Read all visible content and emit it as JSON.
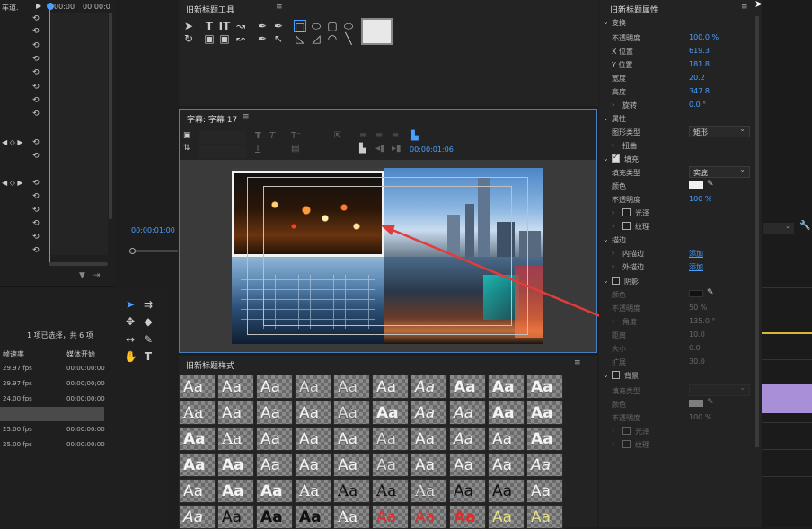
{
  "left_panel": {
    "top_label": "车道.",
    "timecode_top": "00:00",
    "timecode_top_right": "00:00:0",
    "timecode_mid": "00:00:01:00",
    "items_selected": "1 项已选择，共 6 项",
    "col_frame_rate": "帧速率",
    "col_media_start": "媒体开始",
    "rows": [
      {
        "fps": "29.97 fps",
        "start": "00:00:00:00"
      },
      {
        "fps": "29.97 fps",
        "start": "00;00;00;00"
      },
      {
        "fps": "24.00 fps",
        "start": "00:00:00:00"
      },
      {
        "fps": "",
        "start": ""
      },
      {
        "fps": "25.00 fps",
        "start": "00:00:00:00"
      },
      {
        "fps": "25.00 fps",
        "start": "00:00:00:00"
      }
    ]
  },
  "title_tools": {
    "title": "旧新标题工具"
  },
  "title_editor": {
    "title": "字幕: 字幕 17",
    "timecode": "00:00:01:06"
  },
  "title_styles": {
    "title": "旧新标题样式",
    "sample_text": "Aa"
  },
  "properties": {
    "title": "旧新标题属性",
    "transform": {
      "heading": "变换",
      "opacity_label": "不透明度",
      "opacity": "100.0 %",
      "x_label": "X 位置",
      "x": "619.3",
      "y_label": "Y 位置",
      "y": "181.8",
      "width_label": "宽度",
      "width": "20.2",
      "height_label": "高度",
      "height": "347.8",
      "rotation_label": "旋转",
      "rotation": "0.0 °"
    },
    "attributes": {
      "heading": "属性",
      "shape_type_label": "图形类型",
      "shape_type": "矩形",
      "distort_label": "扭曲"
    },
    "fill": {
      "heading": "填充",
      "fill_type_label": "填充类型",
      "fill_type": "实底",
      "color_label": "颜色",
      "color": "#f0f0f0",
      "opacity_label": "不透明度",
      "opacity": "100 %",
      "sheen_label": "光泽",
      "texture_label": "纹理"
    },
    "strokes": {
      "heading": "描边",
      "inner_label": "内描边",
      "inner_add": "添加",
      "outer_label": "外描边",
      "outer_add": "添加"
    },
    "shadow": {
      "heading": "阴影",
      "color_label": "颜色",
      "opacity_label": "不透明度",
      "opacity": "50 %",
      "angle_label": "角度",
      "angle": "135.0 °",
      "distance_label": "距离",
      "distance": "10.0",
      "size_label": "大小",
      "size": "0.0",
      "spread_label": "扩展",
      "spread": "30.0"
    },
    "background": {
      "heading": "背景",
      "fill_type_label": "填充类型",
      "color_label": "颜色",
      "opacity_label": "不透明度",
      "opacity": "100 %",
      "sheen_label": "光泽",
      "texture_label": "纹理"
    }
  },
  "colors": {
    "accent_blue": "#4a9eff",
    "annotation_red": "#e33b3b",
    "timeline_purple": "#a98ed8",
    "timeline_yellow": "#d9b63a"
  }
}
